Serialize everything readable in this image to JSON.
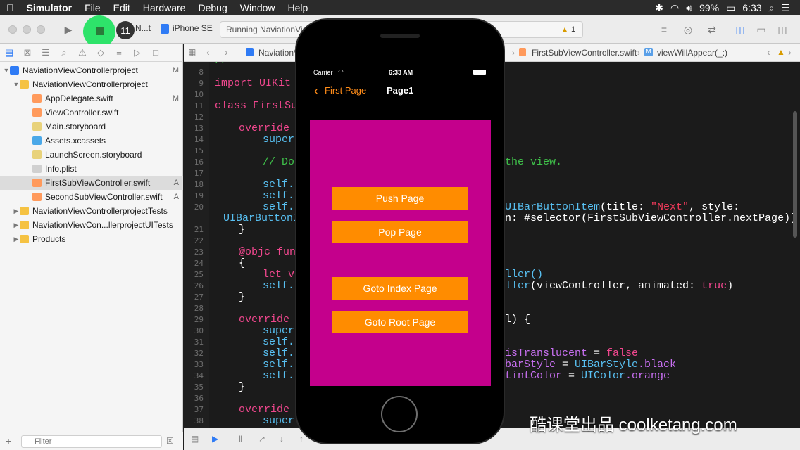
{
  "menubar": {
    "apple_icon": "apple-icon",
    "app_name": "Simulator",
    "items": [
      "File",
      "Edit",
      "Hardware",
      "Debug",
      "Window",
      "Help"
    ],
    "battery": "99%",
    "time": "6:33"
  },
  "toolbar": {
    "scheme_short": "N...t",
    "device": "iPhone SE",
    "stop_badge": "11",
    "status": "Running NaviationViewControllerproject on iPhone SE",
    "warnings": "1"
  },
  "navigator": {
    "project": {
      "label": "NaviationViewControllerproject",
      "badge": "M"
    },
    "group": {
      "label": "NaviationViewControllerproject"
    },
    "files": [
      {
        "label": "AppDelegate.swift",
        "badge": "M"
      },
      {
        "label": "ViewController.swift",
        "badge": ""
      },
      {
        "label": "Main.storyboard",
        "badge": ""
      },
      {
        "label": "Assets.xcassets",
        "badge": ""
      },
      {
        "label": "LaunchScreen.storyboard",
        "badge": ""
      },
      {
        "label": "Info.plist",
        "badge": ""
      },
      {
        "label": "FirstSubViewController.swift",
        "badge": "A"
      },
      {
        "label": "SecondSubViewController.swift",
        "badge": "A"
      }
    ],
    "folders": [
      "NaviationViewControllerprojectTests",
      "NaviationViewCon...llerprojectUITests",
      "Products"
    ],
    "filter_placeholder": "Filter"
  },
  "jumpbar": {
    "project_crumb": "NaviationV",
    "file_crumb": "FirstSubViewController.swift",
    "method_crumb": "viewWillAppear(_:)"
  },
  "editor": {
    "line_numbers": [
      "8",
      "9",
      "10",
      "11",
      "12",
      "13",
      "14",
      "15",
      "16",
      "17",
      "18",
      "19",
      "20",
      "",
      "21",
      "22",
      "23",
      "24",
      "25",
      "26",
      "27",
      "28",
      "29",
      "30",
      "31",
      "32",
      "33",
      "34",
      "35",
      "36",
      "37",
      "38"
    ],
    "line_import": "import UIKit",
    "line_class": "class FirstSu",
    "line_override1": "override",
    "line_super1": "super.",
    "comment_left": "// Do",
    "comment_right": "the view.",
    "self1": "self.t",
    "self2": "self.v",
    "self3": "self.n",
    "right20_type": "UIBarButtonItem",
    "right20_args": "(title: ",
    "right20_str": "\"Next\"",
    "right20_tail": ", style:",
    "left20b": "UIBarButtonI",
    "right20b": "n: #selector(FirstSubViewController.nextPage))",
    "brace_close": "}",
    "objc_line": "@objc func",
    "brace_open": "{",
    "let_line": "let vi",
    "right25": "ller()",
    "self_n": "self.n",
    "right26a": "ller",
    "right26b": "(viewController, animated: ",
    "right26_true": "true",
    "right26_paren": ")",
    "override2": "override f",
    "right29": "l) {",
    "super2": "super.",
    "right32a": "isTranslucent",
    "right32b": " = ",
    "right32c": "false",
    "right33a": "barStyle",
    "right33b": " = ",
    "right33c": "UIBarStyle",
    "right33d": ".black",
    "right34a": "tintColor",
    "right34b": " = ",
    "right34c": "UIColor",
    "right34d": ".orange"
  },
  "simulator": {
    "carrier": "Carrier",
    "time": "6:33 AM",
    "back_label": "First Page",
    "title": "Page1",
    "buttons": [
      "Push Page",
      "Pop Page",
      "Goto Index Page",
      "Goto Root Page"
    ]
  },
  "watermark": "酷课堂出品 coolketang.com",
  "colors": {
    "accent_orange": "#ff8c00",
    "magenta_view": "#c4008c",
    "keyword_pink": "#f0478e",
    "comment_green": "#3fc14a"
  }
}
